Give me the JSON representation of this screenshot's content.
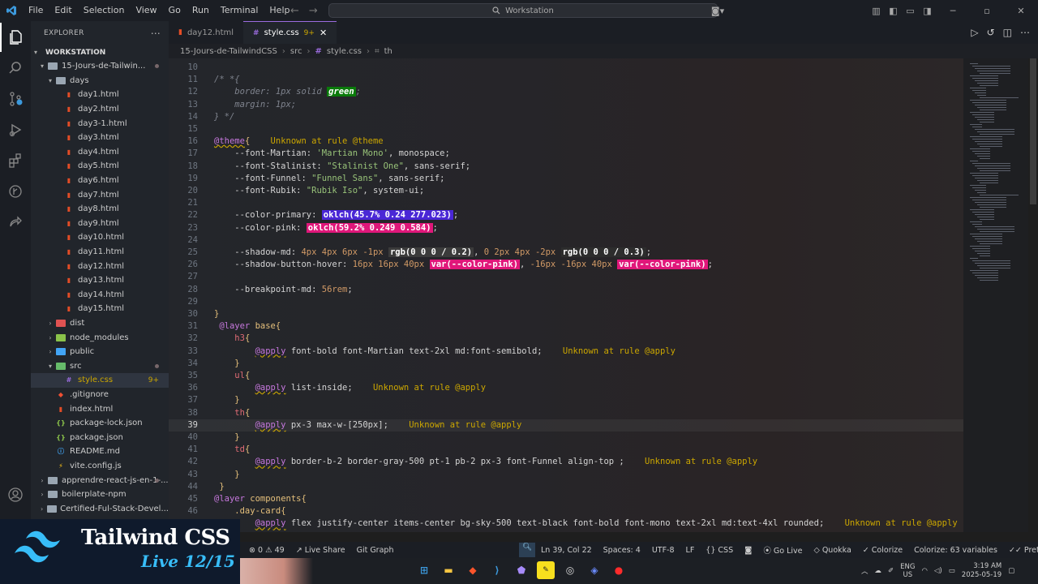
{
  "menu": [
    "File",
    "Edit",
    "Selection",
    "View",
    "Go",
    "Run",
    "Terminal",
    "Help"
  ],
  "search": {
    "label": "Workstation"
  },
  "tabs": [
    {
      "label": "day12.html",
      "active": false
    },
    {
      "label": "style.css",
      "badge": "9+",
      "active": true
    }
  ],
  "breadcrumb": [
    "15-Jours-de-TailwindCSS",
    "src",
    "style.css",
    "th"
  ],
  "sidebar": {
    "title": "EXPLORER",
    "workspace": "WORKSTATION",
    "items": [
      {
        "label": "15-Jours-de-Tailwin...",
        "type": "folder-open",
        "depth": 1,
        "dot": true
      },
      {
        "label": "days",
        "type": "folder-open",
        "depth": 2
      },
      {
        "label": "day1.html",
        "type": "html",
        "depth": 3
      },
      {
        "label": "day2.html",
        "type": "html",
        "depth": 3
      },
      {
        "label": "day3-1.html",
        "type": "html",
        "depth": 3
      },
      {
        "label": "day3.html",
        "type": "html",
        "depth": 3
      },
      {
        "label": "day4.html",
        "type": "html",
        "depth": 3
      },
      {
        "label": "day5.html",
        "type": "html",
        "depth": 3
      },
      {
        "label": "day6.html",
        "type": "html",
        "depth": 3
      },
      {
        "label": "day7.html",
        "type": "html",
        "depth": 3
      },
      {
        "label": "day8.html",
        "type": "html",
        "depth": 3
      },
      {
        "label": "day9.html",
        "type": "html",
        "depth": 3
      },
      {
        "label": "day10.html",
        "type": "html",
        "depth": 3
      },
      {
        "label": "day11.html",
        "type": "html",
        "depth": 3
      },
      {
        "label": "day12.html",
        "type": "html",
        "depth": 3
      },
      {
        "label": "day13.html",
        "type": "html",
        "depth": 3
      },
      {
        "label": "day14.html",
        "type": "html",
        "depth": 3
      },
      {
        "label": "day15.html",
        "type": "html",
        "depth": 3
      },
      {
        "label": "dist",
        "type": "folder",
        "depth": 2,
        "color": "#e05252"
      },
      {
        "label": "node_modules",
        "type": "folder",
        "depth": 2,
        "color": "#8bc34a"
      },
      {
        "label": "public",
        "type": "folder",
        "depth": 2,
        "color": "#42a5f5"
      },
      {
        "label": "src",
        "type": "folder-open",
        "depth": 2,
        "color": "#66bb6a",
        "dot": true
      },
      {
        "label": "style.css",
        "type": "css",
        "depth": 3,
        "badge": "9+",
        "selected": true
      },
      {
        "label": ".gitignore",
        "type": "git",
        "depth": 2
      },
      {
        "label": "index.html",
        "type": "html",
        "depth": 2
      },
      {
        "label": "package-lock.json",
        "type": "json",
        "depth": 2
      },
      {
        "label": "package.json",
        "type": "json",
        "depth": 2
      },
      {
        "label": "README.md",
        "type": "info",
        "depth": 2
      },
      {
        "label": "vite.config.js",
        "type": "vite",
        "depth": 2
      },
      {
        "label": "apprendre-react-js-en-1-...",
        "type": "folder",
        "depth": 1,
        "dot": true
      },
      {
        "label": "boilerplate-npm",
        "type": "folder",
        "depth": 1
      },
      {
        "label": "Certified-Ful-Stack-Devel...",
        "type": "folder",
        "depth": 1
      }
    ]
  },
  "editor": {
    "current_line": 39,
    "lines": [
      {
        "n": "10",
        "tokens": []
      },
      {
        "n": "11",
        "tokens": [
          {
            "t": "/* *{",
            "c": "c-comment"
          }
        ]
      },
      {
        "n": "12",
        "tokens": [
          {
            "t": "    border: 1px solid ",
            "c": "c-comment"
          },
          {
            "t": "green",
            "c": "c-green-box"
          },
          {
            "t": ";",
            "c": "c-comment"
          }
        ]
      },
      {
        "n": "13",
        "tokens": [
          {
            "t": "    margin: 1px;",
            "c": "c-comment"
          }
        ]
      },
      {
        "n": "14",
        "tokens": [
          {
            "t": "} */",
            "c": "c-comment"
          }
        ]
      },
      {
        "n": "15",
        "tokens": []
      },
      {
        "n": "16",
        "tokens": [
          {
            "t": "@theme",
            "c": "c-at"
          },
          {
            "t": "{",
            "c": "c-brace"
          },
          {
            "t": "    Unknown at rule @theme",
            "c": "c-warn"
          }
        ]
      },
      {
        "n": "17",
        "tokens": [
          {
            "t": "    --font-Martian: ",
            "c": "c-prop"
          },
          {
            "t": "'Martian Mono'",
            "c": "c-str"
          },
          {
            "t": ", monospace;",
            "c": "c-prop"
          }
        ]
      },
      {
        "n": "18",
        "tokens": [
          {
            "t": "    --font-Stalinist: ",
            "c": "c-prop"
          },
          {
            "t": "\"Stalinist One\"",
            "c": "c-str"
          },
          {
            "t": ", sans-serif;",
            "c": "c-prop"
          }
        ]
      },
      {
        "n": "19",
        "tokens": [
          {
            "t": "    --font-Funnel: ",
            "c": "c-prop"
          },
          {
            "t": "\"Funnel Sans\"",
            "c": "c-str"
          },
          {
            "t": ", sans-serif;",
            "c": "c-prop"
          }
        ]
      },
      {
        "n": "20",
        "tokens": [
          {
            "t": "    --font-Rubik: ",
            "c": "c-prop"
          },
          {
            "t": "\"Rubik Iso\"",
            "c": "c-str"
          },
          {
            "t": ", system-ui;",
            "c": "c-prop"
          }
        ]
      },
      {
        "n": "21",
        "tokens": []
      },
      {
        "n": "22",
        "tokens": [
          {
            "t": "    --color-primary: ",
            "c": "c-prop"
          },
          {
            "t": "oklch(45.7% 0.24 277.023)",
            "c": "c-swatch",
            "bg": "#4a27d6"
          },
          {
            "t": ";",
            "c": "c-prop"
          }
        ]
      },
      {
        "n": "23",
        "tokens": [
          {
            "t": "    --color-pink: ",
            "c": "c-prop"
          },
          {
            "t": "oklch(59.2% 0.249 0.584)",
            "c": "c-swatch",
            "bg": "#e0177a"
          },
          {
            "t": ";",
            "c": "c-prop"
          }
        ]
      },
      {
        "n": "24",
        "tokens": []
      },
      {
        "n": "25",
        "tokens": [
          {
            "t": "    --shadow-md: ",
            "c": "c-prop"
          },
          {
            "t": "4px 4px 6px -1px ",
            "c": "c-num"
          },
          {
            "t": "rgb(0 0 0 / 0.2)",
            "c": "c-swatch",
            "bg": "#3b3b3b"
          },
          {
            "t": ", ",
            "c": "c-prop"
          },
          {
            "t": "0 2px 4px -2px ",
            "c": "c-num"
          },
          {
            "t": "rgb(0 0 0 / 0.3)",
            "c": "c-swatch",
            "bg": "#2d2d2d"
          },
          {
            "t": ";",
            "c": "c-prop"
          }
        ]
      },
      {
        "n": "26",
        "tokens": [
          {
            "t": "    --shadow-button-hover: ",
            "c": "c-prop"
          },
          {
            "t": "16px 16px 40px ",
            "c": "c-num"
          },
          {
            "t": "var(--color-pink)",
            "c": "c-swatch",
            "bg": "#e0177a"
          },
          {
            "t": ", ",
            "c": "c-prop"
          },
          {
            "t": "-16px -16px 40px ",
            "c": "c-num"
          },
          {
            "t": "var(--color-pink)",
            "c": "c-swatch",
            "bg": "#e0177a"
          },
          {
            "t": ";",
            "c": "c-prop"
          }
        ]
      },
      {
        "n": "27",
        "tokens": []
      },
      {
        "n": "28",
        "tokens": [
          {
            "t": "    --breakpoint-md: ",
            "c": "c-prop"
          },
          {
            "t": "56rem",
            "c": "c-num"
          },
          {
            "t": ";",
            "c": "c-prop"
          }
        ]
      },
      {
        "n": "29",
        "tokens": []
      },
      {
        "n": "30",
        "tokens": [
          {
            "t": "}",
            "c": "c-brace"
          }
        ]
      },
      {
        "n": "31",
        "tokens": [
          {
            "t": " @layer ",
            "c": "c-layer"
          },
          {
            "t": "base",
            "c": "c-name"
          },
          {
            "t": "{",
            "c": "c-brace"
          }
        ]
      },
      {
        "n": "32",
        "tokens": [
          {
            "t": "    h3",
            "c": "c-sel"
          },
          {
            "t": "{",
            "c": "c-brace"
          }
        ]
      },
      {
        "n": "33",
        "tokens": [
          {
            "t": "        ",
            "c": "c-prop"
          },
          {
            "t": "@apply",
            "c": "c-at"
          },
          {
            "t": " font-bold font-Martian text-2xl md:font-semibold;",
            "c": "c-prop"
          },
          {
            "t": "    Unknown at rule @apply",
            "c": "c-warn"
          }
        ]
      },
      {
        "n": "34",
        "tokens": [
          {
            "t": "    }",
            "c": "c-brace"
          }
        ]
      },
      {
        "n": "35",
        "tokens": [
          {
            "t": "    ul",
            "c": "c-sel"
          },
          {
            "t": "{",
            "c": "c-brace"
          }
        ]
      },
      {
        "n": "36",
        "tokens": [
          {
            "t": "        ",
            "c": "c-prop"
          },
          {
            "t": "@apply",
            "c": "c-at"
          },
          {
            "t": " list-inside;",
            "c": "c-prop"
          },
          {
            "t": "    Unknown at rule @apply",
            "c": "c-warn"
          }
        ]
      },
      {
        "n": "37",
        "tokens": [
          {
            "t": "    }",
            "c": "c-brace"
          }
        ]
      },
      {
        "n": "38",
        "tokens": [
          {
            "t": "    th",
            "c": "c-sel"
          },
          {
            "t": "{",
            "c": "c-brace"
          }
        ]
      },
      {
        "n": "39",
        "tokens": [
          {
            "t": "        ",
            "c": "c-prop"
          },
          {
            "t": "@apply",
            "c": "c-at"
          },
          {
            "t": " px-3 max-w-[250px];",
            "c": "c-prop"
          },
          {
            "t": "    Unknown at rule @apply",
            "c": "c-warn"
          }
        ]
      },
      {
        "n": "40",
        "tokens": [
          {
            "t": "    }",
            "c": "c-brace"
          }
        ]
      },
      {
        "n": "41",
        "tokens": [
          {
            "t": "    td",
            "c": "c-sel"
          },
          {
            "t": "{",
            "c": "c-brace"
          }
        ]
      },
      {
        "n": "42",
        "tokens": [
          {
            "t": "        ",
            "c": "c-prop"
          },
          {
            "t": "@apply",
            "c": "c-at"
          },
          {
            "t": " border-b-2 border-gray-500 pt-1 pb-2 px-3 font-Funnel align-top ;",
            "c": "c-prop"
          },
          {
            "t": "    Unknown at rule @apply",
            "c": "c-warn"
          }
        ]
      },
      {
        "n": "43",
        "tokens": [
          {
            "t": "    }",
            "c": "c-brace"
          }
        ]
      },
      {
        "n": "44",
        "tokens": [
          {
            "t": " }",
            "c": "c-brace"
          }
        ]
      },
      {
        "n": "45",
        "tokens": [
          {
            "t": "@layer ",
            "c": "c-layer"
          },
          {
            "t": "components",
            "c": "c-name"
          },
          {
            "t": "{",
            "c": "c-brace"
          }
        ]
      },
      {
        "n": "46",
        "tokens": [
          {
            "t": "    .day-card",
            "c": "c-name"
          },
          {
            "t": "{",
            "c": "c-brace"
          }
        ]
      },
      {
        "n": "47",
        "tokens": [
          {
            "t": "        ",
            "c": "c-prop"
          },
          {
            "t": "@apply",
            "c": "c-at"
          },
          {
            "t": " flex justify-center items-center bg-sky-500 text-black font-bold font-mono text-2xl md:text-4xl rounded;",
            "c": "c-prop"
          },
          {
            "t": "    Unknown at rule @apply",
            "c": "c-warn"
          }
        ]
      }
    ]
  },
  "status": {
    "errors": "0",
    "warnings": "49",
    "live_share": "Live Share",
    "git_graph": "Git Graph",
    "position": "Ln 39, Col 22",
    "spaces": "Spaces: 4",
    "encoding": "UTF-8",
    "eol": "LF",
    "language": "CSS",
    "go_live": "Go Live",
    "quokka": "Quokka",
    "colorize": "Colorize",
    "colorize_vars": "Colorize: 63 variables",
    "prettier": "Prettier"
  },
  "banner": {
    "title": "Tailwind CSS",
    "subtitle": "Live 12/15"
  },
  "taskbar": {
    "lang_top": "ENG",
    "lang_bottom": "US",
    "time": "3:19 AM",
    "date": "2025-05-19"
  },
  "colors": {
    "accent": "#9b6cde",
    "tailwind": "#38bdf8",
    "warning": "#cca700"
  }
}
